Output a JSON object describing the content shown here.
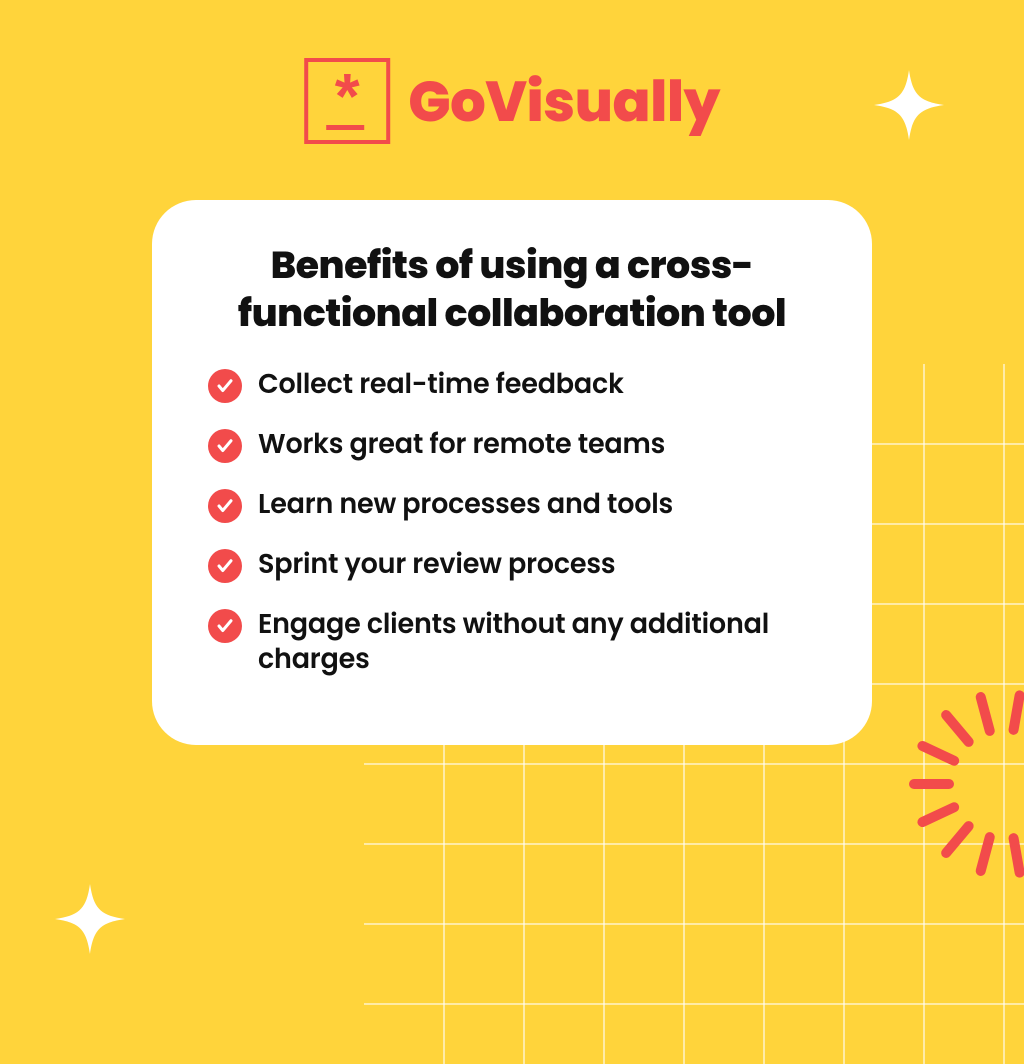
{
  "brand": "GoVisually",
  "colors": {
    "background": "#FFD43B",
    "accent": "#F24B4B",
    "card": "#FFFFFF",
    "text": "#111111"
  },
  "card": {
    "title": "Benefits of using a cross-functional collaboration tool",
    "benefits": [
      "Collect real-time feedback",
      "Works great for remote teams",
      "Learn new processes and tools",
      "Sprint your review process",
      "Engage clients without any additional charges"
    ]
  },
  "decor": {
    "sparkle_tr": "sparkle-icon",
    "sparkle_bl": "sparkle-icon",
    "radial_burst": "radial-burst-icon",
    "grid": "grid-pattern"
  }
}
